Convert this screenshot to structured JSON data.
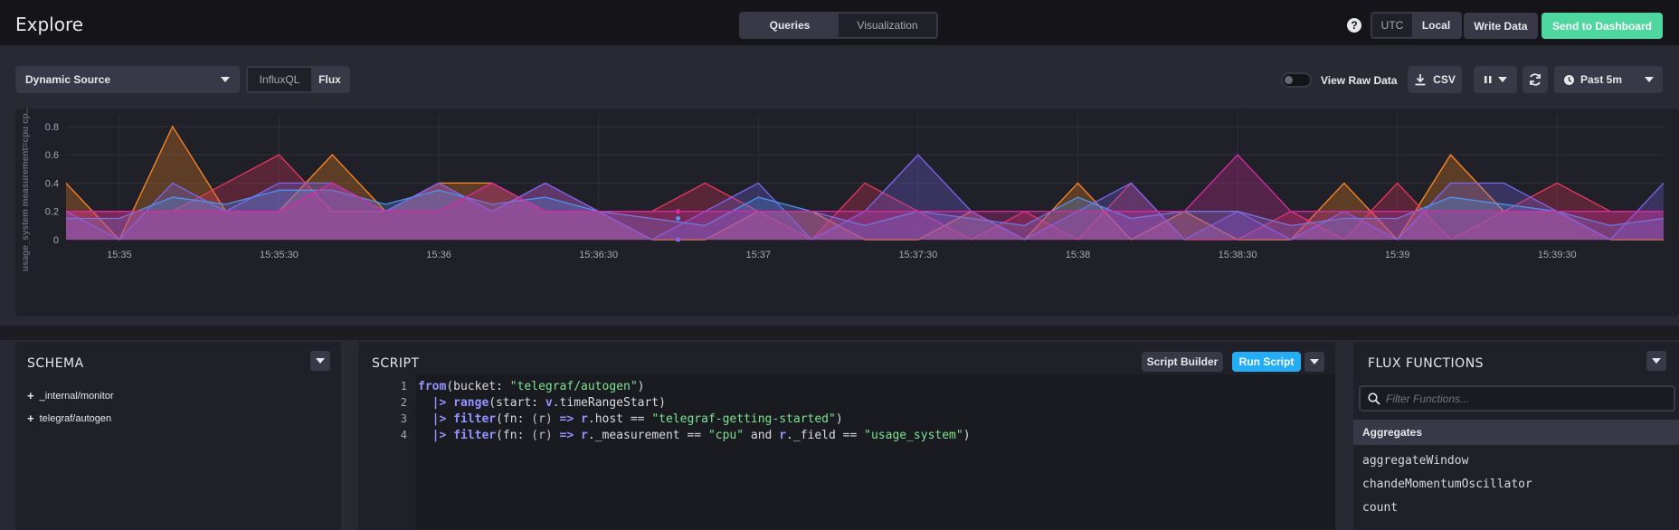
{
  "header": {
    "title": "Explore",
    "tabs": [
      {
        "label": "Queries",
        "active": true
      },
      {
        "label": "Visualization",
        "active": false
      }
    ],
    "help_label": "?",
    "timezone": [
      "UTC",
      "Local"
    ],
    "write_data_label": "Write Data",
    "send_dashboard_label": "Send to Dashboard"
  },
  "controls": {
    "source_label": "Dynamic Source",
    "query_lang": [
      "InfluxQL",
      "Flux"
    ],
    "view_raw_label": "View Raw Data",
    "csv_label": "CSV",
    "range_label": "Past 5m"
  },
  "chart_data": {
    "type": "area",
    "ylabel": "usage_system measurement=cpu cp...",
    "y_ticks": [
      "0.8",
      "0.6",
      "0.4",
      "0.2",
      "0"
    ],
    "ylim": [
      0,
      0.85
    ],
    "x_ticks": [
      "15:35",
      "15:35:30",
      "15:36",
      "15:36:30",
      "15:37",
      "15:37:30",
      "15:38",
      "15:38:30",
      "15:39",
      "15:39:30"
    ],
    "x": [
      "15:34:50",
      "15:35",
      "15:35:10",
      "15:35:20",
      "15:35:30",
      "15:35:40",
      "15:35:50",
      "15:36",
      "15:36:10",
      "15:36:20",
      "15:36:30",
      "15:36:40",
      "15:36:50",
      "15:37",
      "15:37:10",
      "15:37:20",
      "15:37:30",
      "15:37:40",
      "15:37:50",
      "15:38",
      "15:38:10",
      "15:38:20",
      "15:38:30",
      "15:38:40",
      "15:38:50",
      "15:39",
      "15:39:10",
      "15:39:20",
      "15:39:30",
      "15:39:40",
      "15:39:50"
    ],
    "series": [
      {
        "color": "#ff8826",
        "values": [
          0.4,
          0.0,
          0.8,
          0.2,
          0.2,
          0.6,
          0.2,
          0.4,
          0.4,
          0.2,
          0.2,
          0.0,
          0.0,
          0.2,
          0.2,
          0.0,
          0.0,
          0.2,
          0.0,
          0.4,
          0.0,
          0.2,
          0.0,
          0.0,
          0.4,
          0.0,
          0.6,
          0.2,
          0.2,
          0.0,
          0.0
        ]
      },
      {
        "color": "#e8375c",
        "values": [
          0.2,
          0.2,
          0.2,
          0.4,
          0.6,
          0.2,
          0.2,
          0.4,
          0.2,
          0.4,
          0.2,
          0.2,
          0.4,
          0.2,
          0.0,
          0.4,
          0.2,
          0.0,
          0.2,
          0.0,
          0.4,
          0.0,
          0.0,
          0.2,
          0.0,
          0.4,
          0.0,
          0.2,
          0.4,
          0.2,
          0.2
        ]
      },
      {
        "color": "#7a65f2",
        "values": [
          0.2,
          0.0,
          0.4,
          0.2,
          0.4,
          0.4,
          0.2,
          0.4,
          0.2,
          0.4,
          0.2,
          0.0,
          0.2,
          0.4,
          0.0,
          0.2,
          0.6,
          0.2,
          0.0,
          0.2,
          0.4,
          0.0,
          0.2,
          0.0,
          0.2,
          0.0,
          0.4,
          0.4,
          0.2,
          0.0,
          0.4
        ]
      },
      {
        "color": "#4e94f0",
        "values": [
          0.15,
          0.15,
          0.3,
          0.25,
          0.35,
          0.35,
          0.25,
          0.35,
          0.25,
          0.3,
          0.2,
          0.15,
          0.1,
          0.3,
          0.2,
          0.1,
          0.2,
          0.15,
          0.1,
          0.3,
          0.15,
          0.2,
          0.2,
          0.1,
          0.15,
          0.15,
          0.3,
          0.25,
          0.2,
          0.1,
          0.15
        ]
      },
      {
        "color": "#d62aa5",
        "values": [
          0.2,
          0.2,
          0.2,
          0.2,
          0.2,
          0.4,
          0.2,
          0.2,
          0.4,
          0.2,
          0.2,
          0.2,
          0.2,
          0.2,
          0.2,
          0.2,
          0.2,
          0.2,
          0.2,
          0.2,
          0.2,
          0.2,
          0.6,
          0.2,
          0.2,
          0.2,
          0.2,
          0.2,
          0.2,
          0.2,
          0.2
        ]
      }
    ]
  },
  "schema": {
    "title": "SCHEMA",
    "items": [
      "_internal/monitor",
      "telegraf/autogen"
    ]
  },
  "script": {
    "title": "SCRIPT",
    "builder_label": "Script Builder",
    "run_label": "Run Script",
    "line_numbers": [
      "1",
      "2",
      "3",
      "4"
    ],
    "l1": {
      "fn": "from",
      "a": "(bucket: ",
      "s": "\"telegraf/autogen\"",
      "b": ")"
    },
    "l2": {
      "pipe": "|>",
      "fn": "range",
      "a": "(start: ",
      "v": "v",
      "b": ".timeRangeStart)"
    },
    "l3": {
      "pipe": "|>",
      "fn": "filter",
      "a": "(fn: ",
      "r1": "(r)",
      "arrow": " => ",
      "r2": "r",
      "b": ".host == ",
      "s": "\"telegraf-getting-started\"",
      "c": ")"
    },
    "l4": {
      "pipe": "|>",
      "fn": "filter",
      "a": "(fn: ",
      "r1": "(r)",
      "arrow": " => ",
      "r2": "r",
      "b": "._measurement == ",
      "s1": "\"cpu\"",
      "and": " and ",
      "r3": "r",
      "c": "._field == ",
      "s2": "\"usage_system\"",
      "d": ")"
    }
  },
  "functions": {
    "title": "FLUX FUNCTIONS",
    "filter_placeholder": "Filter Functions...",
    "category": "Aggregates",
    "items": [
      "aggregateWindow",
      "chandeMomentumOscillator",
      "count"
    ]
  }
}
